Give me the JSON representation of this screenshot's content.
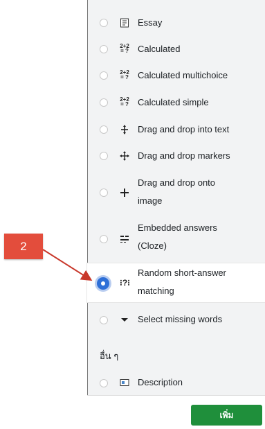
{
  "question_types": [
    {
      "label": "Essay",
      "icon": "essay-icon",
      "selected": false
    },
    {
      "label": "Calculated",
      "icon": "calculated-icon",
      "selected": false
    },
    {
      "label": "Calculated multichoice",
      "icon": "calculated-multichoice-icon",
      "selected": false
    },
    {
      "label": "Calculated simple",
      "icon": "calculated-simple-icon",
      "selected": false
    },
    {
      "label": "Drag and drop into text",
      "icon": "drag-drop-text-icon",
      "selected": false
    },
    {
      "label": "Drag and drop markers",
      "icon": "drag-drop-markers-icon",
      "selected": false
    },
    {
      "label": "Drag and drop onto image",
      "icon": "drag-drop-image-icon",
      "selected": false
    },
    {
      "label": "Embedded answers (Cloze)",
      "icon": "cloze-icon",
      "selected": false
    },
    {
      "label": "Random short-answer matching",
      "icon": "random-match-icon",
      "selected": true
    },
    {
      "label": "Select missing words",
      "icon": "select-missing-icon",
      "selected": false
    }
  ],
  "other_section": {
    "title": "อื่น ๆ",
    "items": [
      {
        "label": "Description",
        "icon": "description-icon",
        "selected": false
      }
    ]
  },
  "footer": {
    "add_label": "เพิ่ม"
  },
  "callout": {
    "number": "2"
  },
  "colors": {
    "accent": "#2e6fd7",
    "add_button": "#1f8f3b",
    "callout": "#e34d3c"
  }
}
